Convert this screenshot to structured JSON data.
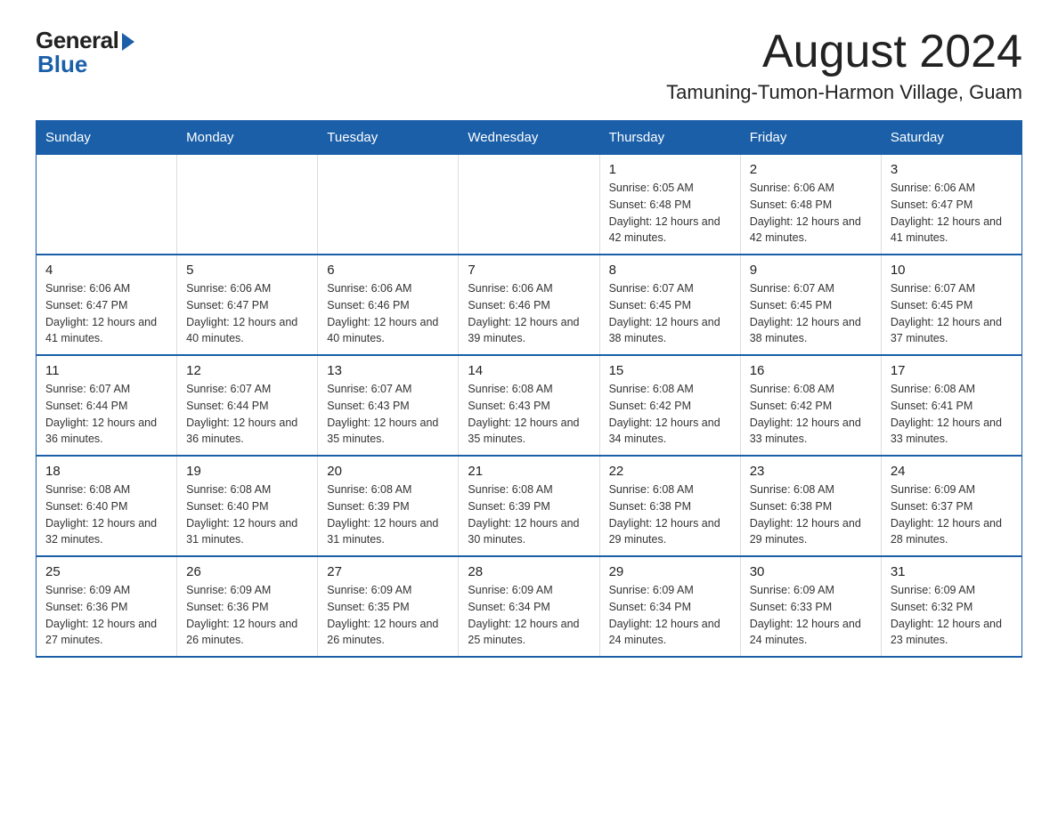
{
  "logo": {
    "general": "General",
    "blue": "Blue"
  },
  "title": {
    "month_year": "August 2024",
    "location": "Tamuning-Tumon-Harmon Village, Guam"
  },
  "headers": [
    "Sunday",
    "Monday",
    "Tuesday",
    "Wednesday",
    "Thursday",
    "Friday",
    "Saturday"
  ],
  "weeks": [
    [
      {
        "day": "",
        "info": ""
      },
      {
        "day": "",
        "info": ""
      },
      {
        "day": "",
        "info": ""
      },
      {
        "day": "",
        "info": ""
      },
      {
        "day": "1",
        "info": "Sunrise: 6:05 AM\nSunset: 6:48 PM\nDaylight: 12 hours and 42 minutes."
      },
      {
        "day": "2",
        "info": "Sunrise: 6:06 AM\nSunset: 6:48 PM\nDaylight: 12 hours and 42 minutes."
      },
      {
        "day": "3",
        "info": "Sunrise: 6:06 AM\nSunset: 6:47 PM\nDaylight: 12 hours and 41 minutes."
      }
    ],
    [
      {
        "day": "4",
        "info": "Sunrise: 6:06 AM\nSunset: 6:47 PM\nDaylight: 12 hours and 41 minutes."
      },
      {
        "day": "5",
        "info": "Sunrise: 6:06 AM\nSunset: 6:47 PM\nDaylight: 12 hours and 40 minutes."
      },
      {
        "day": "6",
        "info": "Sunrise: 6:06 AM\nSunset: 6:46 PM\nDaylight: 12 hours and 40 minutes."
      },
      {
        "day": "7",
        "info": "Sunrise: 6:06 AM\nSunset: 6:46 PM\nDaylight: 12 hours and 39 minutes."
      },
      {
        "day": "8",
        "info": "Sunrise: 6:07 AM\nSunset: 6:45 PM\nDaylight: 12 hours and 38 minutes."
      },
      {
        "day": "9",
        "info": "Sunrise: 6:07 AM\nSunset: 6:45 PM\nDaylight: 12 hours and 38 minutes."
      },
      {
        "day": "10",
        "info": "Sunrise: 6:07 AM\nSunset: 6:45 PM\nDaylight: 12 hours and 37 minutes."
      }
    ],
    [
      {
        "day": "11",
        "info": "Sunrise: 6:07 AM\nSunset: 6:44 PM\nDaylight: 12 hours and 36 minutes."
      },
      {
        "day": "12",
        "info": "Sunrise: 6:07 AM\nSunset: 6:44 PM\nDaylight: 12 hours and 36 minutes."
      },
      {
        "day": "13",
        "info": "Sunrise: 6:07 AM\nSunset: 6:43 PM\nDaylight: 12 hours and 35 minutes."
      },
      {
        "day": "14",
        "info": "Sunrise: 6:08 AM\nSunset: 6:43 PM\nDaylight: 12 hours and 35 minutes."
      },
      {
        "day": "15",
        "info": "Sunrise: 6:08 AM\nSunset: 6:42 PM\nDaylight: 12 hours and 34 minutes."
      },
      {
        "day": "16",
        "info": "Sunrise: 6:08 AM\nSunset: 6:42 PM\nDaylight: 12 hours and 33 minutes."
      },
      {
        "day": "17",
        "info": "Sunrise: 6:08 AM\nSunset: 6:41 PM\nDaylight: 12 hours and 33 minutes."
      }
    ],
    [
      {
        "day": "18",
        "info": "Sunrise: 6:08 AM\nSunset: 6:40 PM\nDaylight: 12 hours and 32 minutes."
      },
      {
        "day": "19",
        "info": "Sunrise: 6:08 AM\nSunset: 6:40 PM\nDaylight: 12 hours and 31 minutes."
      },
      {
        "day": "20",
        "info": "Sunrise: 6:08 AM\nSunset: 6:39 PM\nDaylight: 12 hours and 31 minutes."
      },
      {
        "day": "21",
        "info": "Sunrise: 6:08 AM\nSunset: 6:39 PM\nDaylight: 12 hours and 30 minutes."
      },
      {
        "day": "22",
        "info": "Sunrise: 6:08 AM\nSunset: 6:38 PM\nDaylight: 12 hours and 29 minutes."
      },
      {
        "day": "23",
        "info": "Sunrise: 6:08 AM\nSunset: 6:38 PM\nDaylight: 12 hours and 29 minutes."
      },
      {
        "day": "24",
        "info": "Sunrise: 6:09 AM\nSunset: 6:37 PM\nDaylight: 12 hours and 28 minutes."
      }
    ],
    [
      {
        "day": "25",
        "info": "Sunrise: 6:09 AM\nSunset: 6:36 PM\nDaylight: 12 hours and 27 minutes."
      },
      {
        "day": "26",
        "info": "Sunrise: 6:09 AM\nSunset: 6:36 PM\nDaylight: 12 hours and 26 minutes."
      },
      {
        "day": "27",
        "info": "Sunrise: 6:09 AM\nSunset: 6:35 PM\nDaylight: 12 hours and 26 minutes."
      },
      {
        "day": "28",
        "info": "Sunrise: 6:09 AM\nSunset: 6:34 PM\nDaylight: 12 hours and 25 minutes."
      },
      {
        "day": "29",
        "info": "Sunrise: 6:09 AM\nSunset: 6:34 PM\nDaylight: 12 hours and 24 minutes."
      },
      {
        "day": "30",
        "info": "Sunrise: 6:09 AM\nSunset: 6:33 PM\nDaylight: 12 hours and 24 minutes."
      },
      {
        "day": "31",
        "info": "Sunrise: 6:09 AM\nSunset: 6:32 PM\nDaylight: 12 hours and 23 minutes."
      }
    ]
  ]
}
